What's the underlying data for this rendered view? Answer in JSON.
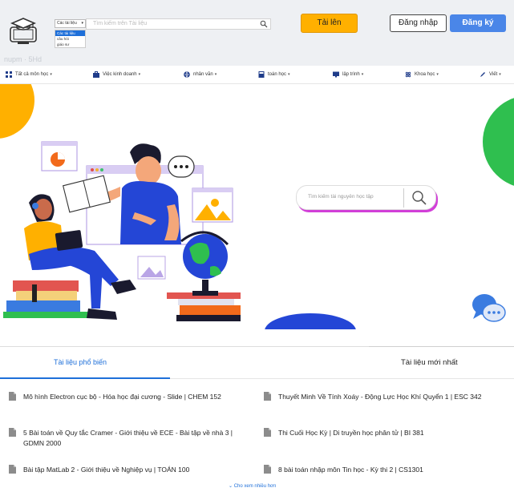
{
  "header": {
    "category_selected": "Các tài liệu",
    "category_options": [
      "Các tài liệu",
      "câu hỏi",
      "giáo sư"
    ],
    "search_placeholder": "Tìm kiếm trên Tài liệu",
    "upload_label": "Tải lên",
    "login_label": "Đăng nhập",
    "signup_label": "Đăng ký",
    "ghost_text": "nupm · 5Hd",
    "accent_color": "#ffb000",
    "primary_color": "#4a86e8"
  },
  "nav": {
    "items": [
      {
        "label": "Tất cả môn học",
        "icon": "grid-icon"
      },
      {
        "label": "Việc kinh doanh",
        "icon": "briefcase-icon"
      },
      {
        "label": "nhân văn",
        "icon": "globe-icon"
      },
      {
        "label": "toán học",
        "icon": "calculator-icon"
      },
      {
        "label": "lập trình",
        "icon": "monitor-icon"
      },
      {
        "label": "Khoa học",
        "icon": "atom-icon"
      },
      {
        "label": "Viết",
        "icon": "pen-icon"
      }
    ]
  },
  "hero": {
    "search_placeholder": "Tìm kiếm tài nguyên học tập"
  },
  "tabs": {
    "popular": "Tài liệu phổ biến",
    "newest": "Tài liệu mới nhất"
  },
  "docs": {
    "left": [
      "Mô hình Electron cục bộ - Hóa học đại cương - Slide | CHEM 152",
      "5 Bài toán về Quy tắc Cramer - Giới thiệu về ECE - Bài tập về nhà 3 | GDMN 2000",
      "Bài tập MatLab 2 - Giới thiệu về Nghiệp vụ | TOÁN 100"
    ],
    "right": [
      "Thuyết Minh Về Tính Xoáy - Động Lực Học Khí Quyển 1 | ESC 342",
      "Thi Cuối Học Kỳ | Di truyền học phân tử | BI 381",
      "8 bài toán nhập môn Tin học - Kỳ thi 2 | CS1301"
    ]
  },
  "more_label": "⌄ Cho xem nhiều hơn"
}
